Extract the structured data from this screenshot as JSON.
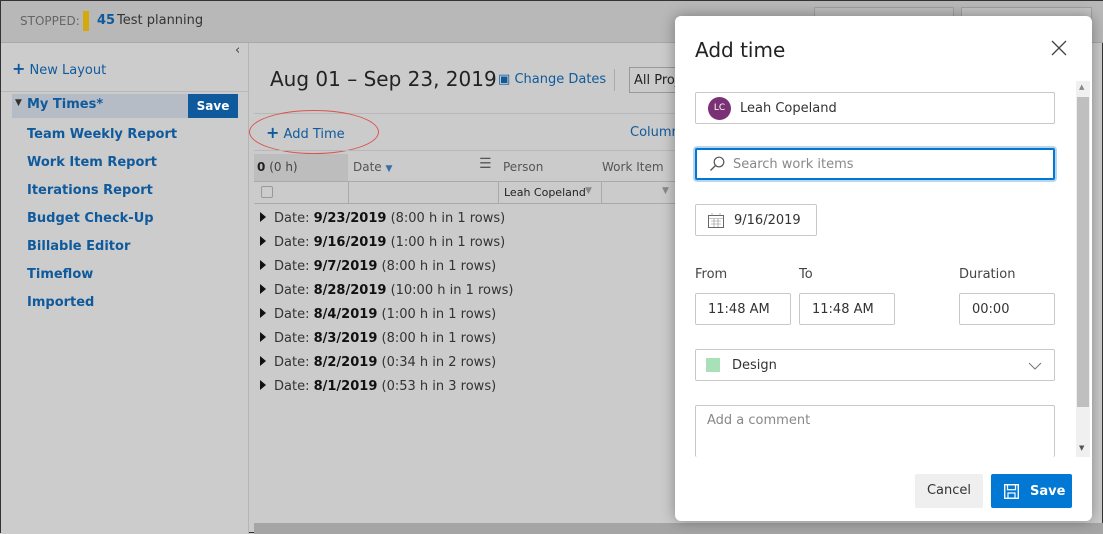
{
  "topbar": {
    "status_label": "STOPPED:",
    "item_id": "45",
    "item_title": "Test planning",
    "status_color": "#d4a90c"
  },
  "sidebar": {
    "new_layout": "New Layout",
    "active": {
      "label": "My Times*",
      "save": "Save"
    },
    "items": [
      {
        "label": "Team Weekly Report"
      },
      {
        "label": "Work Item Report"
      },
      {
        "label": "Iterations Report"
      },
      {
        "label": "Budget Check-Up"
      },
      {
        "label": "Billable Editor"
      },
      {
        "label": "Timeflow"
      },
      {
        "label": "Imported"
      }
    ]
  },
  "main": {
    "date_range": "Aug 01 – Sep 23, 2019",
    "change_dates": "Change Dates",
    "project_select": "All Proj",
    "add_time": "Add Time",
    "columns": "Column",
    "grid": {
      "total": "0 (0 h)",
      "headers": {
        "date": "Date",
        "person": "Person",
        "work_item": "Work Item"
      },
      "person_filter": "Leah Copeland"
    },
    "groups": [
      {
        "prefix": "Date: ",
        "date": "9/23/2019",
        "summary": "(8:00 h in 1 rows)"
      },
      {
        "prefix": "Date: ",
        "date": "9/16/2019",
        "summary": "(1:00 h in 1 rows)"
      },
      {
        "prefix": "Date: ",
        "date": "9/7/2019",
        "summary": "(8:00 h in 1 rows)"
      },
      {
        "prefix": "Date: ",
        "date": "8/28/2019",
        "summary": "(10:00 h in 1 rows)"
      },
      {
        "prefix": "Date: ",
        "date": "8/4/2019",
        "summary": "(1:00 h in 1 rows)"
      },
      {
        "prefix": "Date: ",
        "date": "8/3/2019",
        "summary": "(8:00 h in 1 rows)"
      },
      {
        "prefix": "Date: ",
        "date": "8/2/2019",
        "summary": "(0:34 h in 2 rows)"
      },
      {
        "prefix": "Date: ",
        "date": "8/1/2019",
        "summary": "(0:53 h in 3 rows)"
      }
    ]
  },
  "dialog": {
    "title": "Add time",
    "person": {
      "initials": "LC",
      "name": "Leah Copeland",
      "avatar_color": "#7a3275"
    },
    "search_placeholder": "Search work items",
    "date": "9/16/2019",
    "from_label": "From",
    "to_label": "To",
    "duration_label": "Duration",
    "from": "11:48 AM",
    "to": "11:48 AM",
    "duration": "00:00",
    "category": {
      "label": "Design",
      "color": "#a8e0b8"
    },
    "comment_placeholder": "Add a comment",
    "cancel": "Cancel",
    "save": "Save",
    "accent": "#0078d4"
  }
}
